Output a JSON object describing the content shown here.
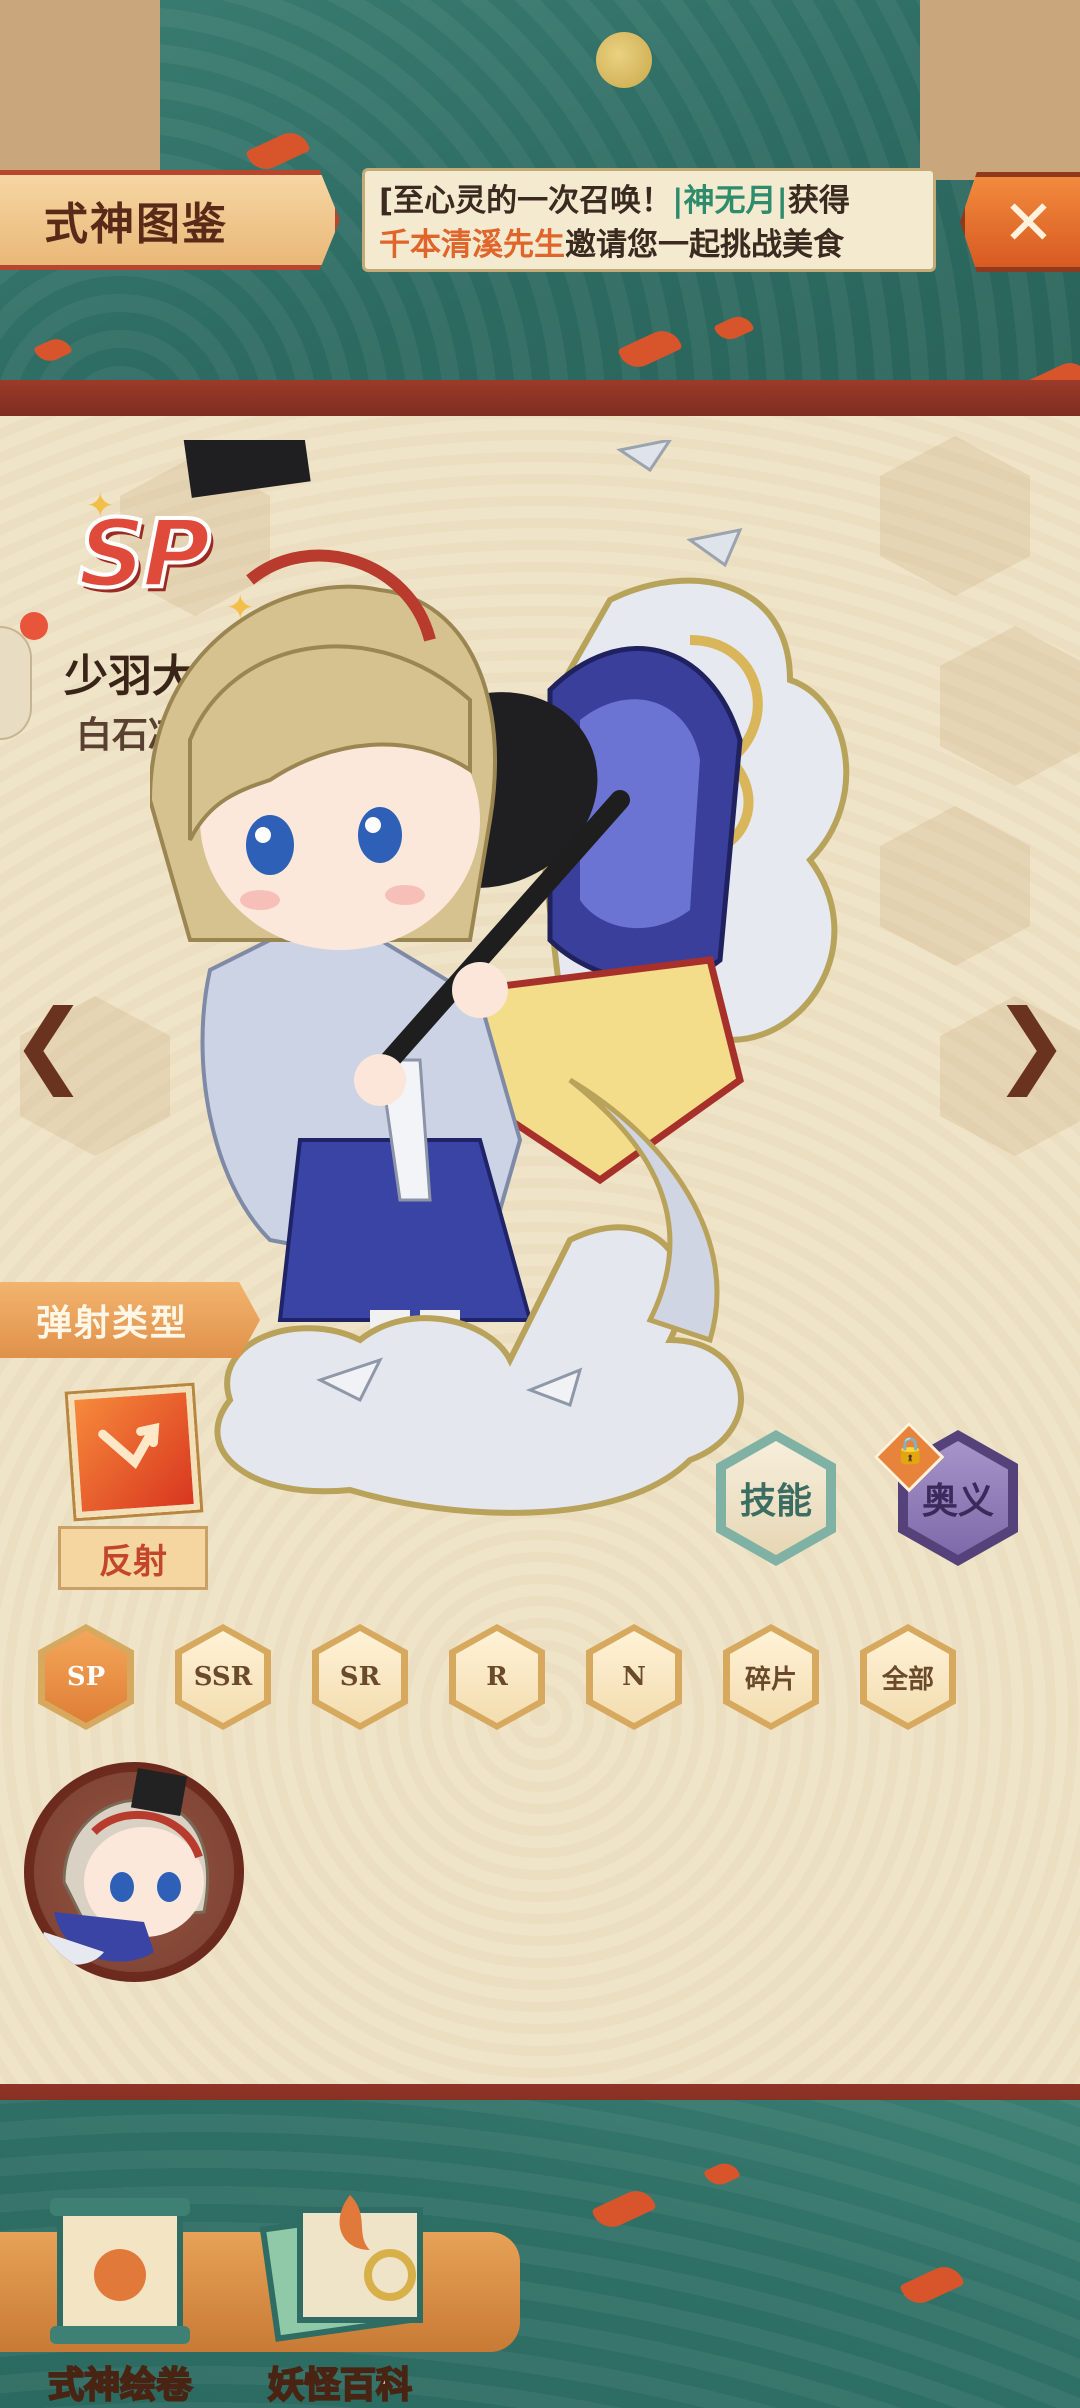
{
  "header": {
    "title": "式神图鉴",
    "marquee_line1_a": "[至心灵的一次召唤！",
    "marquee_line1_b": "|神无月|",
    "marquee_line1_c": "获得",
    "marquee_line2_a": "千本清溪先生",
    "marquee_line2_b": "邀请您一起挑战美食",
    "close_icon": "close-icon"
  },
  "shikigami": {
    "rarity": "SP",
    "name": "少羽大天狗",
    "voice_actor": "白石凉子"
  },
  "nav": {
    "prev_icon": "chevron-left-icon",
    "next_icon": "chevron-right-icon",
    "prev_glyph": "❮",
    "next_glyph": "❯"
  },
  "type": {
    "header": "弹射类型",
    "label": "反射"
  },
  "actions": {
    "skill": "技能",
    "mystery": "奥义"
  },
  "filters": [
    "SP",
    "SSR",
    "SR",
    "R",
    "N",
    "碎片",
    "全部"
  ],
  "bottom_nav": {
    "scroll": "式神绘卷",
    "encyclopedia": "妖怪百科"
  },
  "colors": {
    "accent": "#d85a22",
    "panel": "#efe3c8",
    "backdrop": "#2f6d64",
    "frame": "#8f3426"
  }
}
